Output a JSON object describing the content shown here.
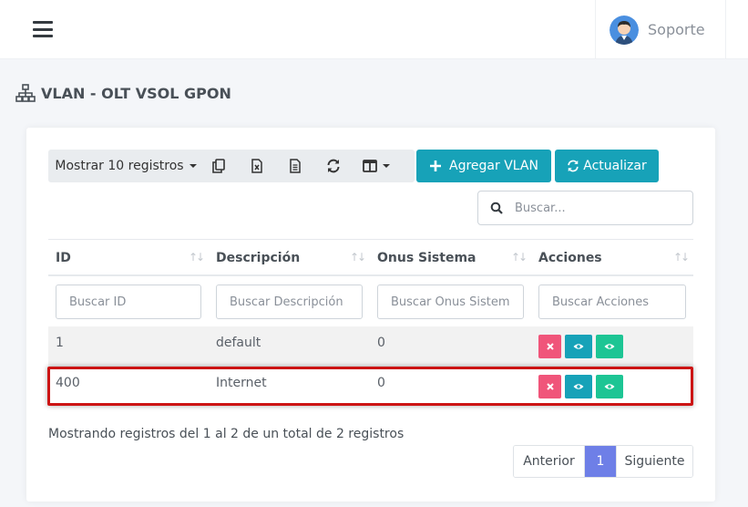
{
  "header": {
    "user_name": "Soporte"
  },
  "page": {
    "title": "VLAN - OLT VSOL GPON"
  },
  "toolbar": {
    "show_label": "Mostrar 10 registros",
    "add_label": "Agregar VLAN",
    "refresh_label": "Actualizar"
  },
  "search": {
    "placeholder": "Buscar..."
  },
  "table": {
    "columns": [
      "ID",
      "Descripción",
      "Onus Sistema",
      "Acciones"
    ],
    "filters": [
      "Buscar ID",
      "Buscar Descripción",
      "Buscar Onus Sistem",
      "Buscar Acciones"
    ],
    "rows": [
      {
        "id": "1",
        "description": "default",
        "onus": "0"
      },
      {
        "id": "400",
        "description": "Internet",
        "onus": "0"
      }
    ]
  },
  "footer": {
    "info": "Mostrando registros del 1 al 2 de un total de 2 registros",
    "prev_label": "Anterior",
    "current_page": "1",
    "next_label": "Siguiente"
  },
  "colors": {
    "info_button": "#17a2b8",
    "delete_button": "#f0557a",
    "view_button_teal": "#17a2b8",
    "view_button_green": "#1dc594",
    "active_page": "#6e7fe7",
    "highlight_border": "#cc1414"
  },
  "icons": [
    "menu-icon",
    "avatar-icon",
    "sitemap-icon",
    "copy-icon",
    "excel-icon",
    "pdf-icon",
    "sync-icon",
    "columns-icon",
    "plus-icon",
    "refresh-icon",
    "search-icon",
    "close-icon",
    "eye-icon"
  ]
}
